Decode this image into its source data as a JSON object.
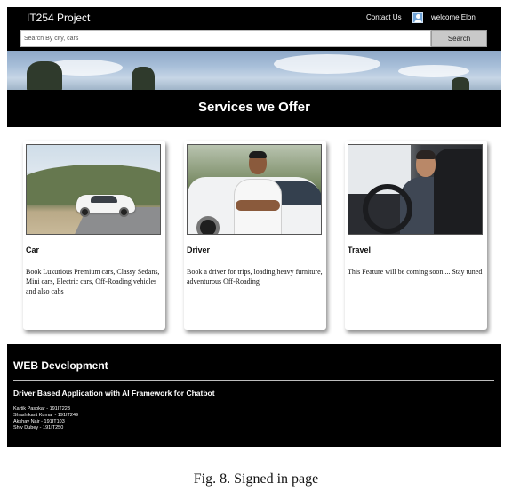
{
  "navbar": {
    "brand": "IT254 Project",
    "contact_label": "Contact Us",
    "welcome_text": "welcome Elon",
    "avatar_icon": "user-avatar-icon"
  },
  "search": {
    "placeholder": "Search By city, cars",
    "button_label": "Search"
  },
  "services": {
    "heading": "Services we Offer",
    "cards": [
      {
        "title": "Car",
        "description": "Book Luxurious Premium cars, Classy Sedans, Mini cars, Electric cars, Off-Roading vehicles and also cabs",
        "image": "white-electric-car-photo"
      },
      {
        "title": "Driver",
        "description": "Book a driver for trips, loading heavy furniture, adventurous Off-Roading",
        "image": "driver-standing-by-car-photo"
      },
      {
        "title": "Travel",
        "description": "This Feature will be coming soon.... Stay tuned",
        "image": "person-driving-car-photo"
      }
    ]
  },
  "footer": {
    "title": "WEB Development",
    "subtitle": "Driver Based Application with AI Framework for Chatbot",
    "members": [
      "Kartik Pasokar - 191IT223",
      "Shashikant Kumar - 191IT249",
      "Akshay Nair - 191IT103",
      "Shiv Dubey - 191IT250"
    ]
  },
  "caption": "Fig. 8.  Signed in page",
  "colors": {
    "navbar_bg": "#000000",
    "search_button_bg": "#c9c9c9",
    "footer_bg": "#000000",
    "text_on_dark": "#ffffff"
  }
}
